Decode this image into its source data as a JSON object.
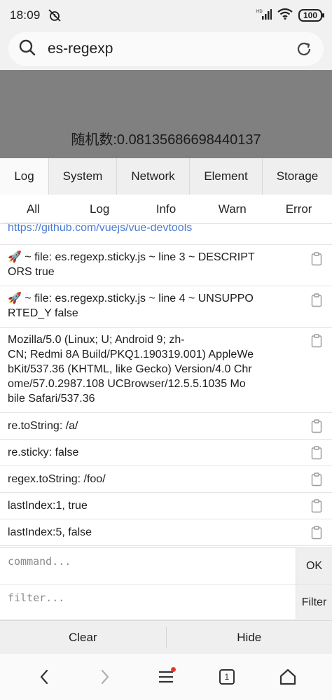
{
  "status_bar": {
    "time": "18:09",
    "battery": "100"
  },
  "browser": {
    "query": "es-regexp"
  },
  "page": {
    "random_label": "随机数:0.08135686698440137"
  },
  "console": {
    "tabs": [
      "Log",
      "System",
      "Network",
      "Element",
      "Storage"
    ],
    "active_tab": "Log",
    "subtabs": [
      "All",
      "Log",
      "Info",
      "Warn",
      "Error"
    ],
    "active_subtab": "All",
    "logs": [
      {
        "text": "https://github.com/vuejs/vue-devtools"
      },
      {
        "lines": [
          "🚀 ~ file: es.regexp.sticky.js ~ line 3 ~ DESCRIPT",
          "ORS true"
        ]
      },
      {
        "lines": [
          "🚀 ~ file: es.regexp.sticky.js ~ line 4 ~ UNSUPPO",
          "RTED_Y false"
        ]
      },
      {
        "lines": [
          "Mozilla/5.0 (Linux; U; Android 9; zh-",
          "CN; Redmi 8A Build/PKQ1.190319.001) AppleWe",
          "bKit/537.36 (KHTML, like Gecko) Version/4.0 Chr",
          "ome/57.0.2987.108 UCBrowser/12.5.5.1035 Mo",
          "bile Safari/537.36"
        ]
      },
      {
        "text": "re.toString: /a/"
      },
      {
        "text": "re.sticky: false"
      },
      {
        "text": "regex.toString: /foo/"
      },
      {
        "text": "lastIndex:1, true"
      },
      {
        "text": "lastIndex:5, false"
      }
    ],
    "command_placeholder": "command...",
    "ok_label": "OK",
    "filter_placeholder": "filter...",
    "filter_label": "Filter",
    "clear_label": "Clear",
    "hide_label": "Hide"
  },
  "bottom_nav": {
    "tabs_count": "1"
  }
}
